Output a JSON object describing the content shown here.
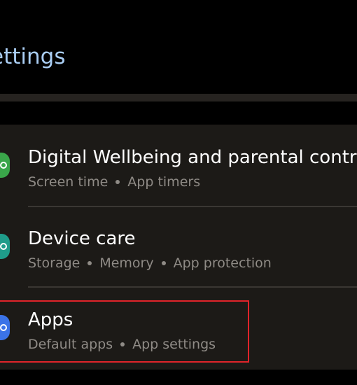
{
  "header": {
    "title": "ettings"
  },
  "settings_list": {
    "items": [
      {
        "title": "Digital Wellbeing and parental contro",
        "subtitle_parts": [
          "Screen time",
          "App timers"
        ],
        "icon": "digital-wellbeing-icon",
        "icon_color": "#3aa64a"
      },
      {
        "title": "Device care",
        "subtitle_parts": [
          "Storage",
          "Memory",
          "App protection"
        ],
        "icon": "device-care-icon",
        "icon_color": "#1f9c8a"
      },
      {
        "title": "Apps",
        "subtitle_parts": [
          "Default apps",
          "App settings"
        ],
        "icon": "apps-icon",
        "icon_color": "#3b73e8"
      }
    ]
  },
  "highlight": {
    "color": "#e0242a",
    "target": "Apps"
  },
  "colors": {
    "background": "#000000",
    "card": "#1c1a17",
    "title_accent": "#a9cdf3",
    "primary_text": "#ffffff",
    "secondary_text": "#8f8b86"
  }
}
